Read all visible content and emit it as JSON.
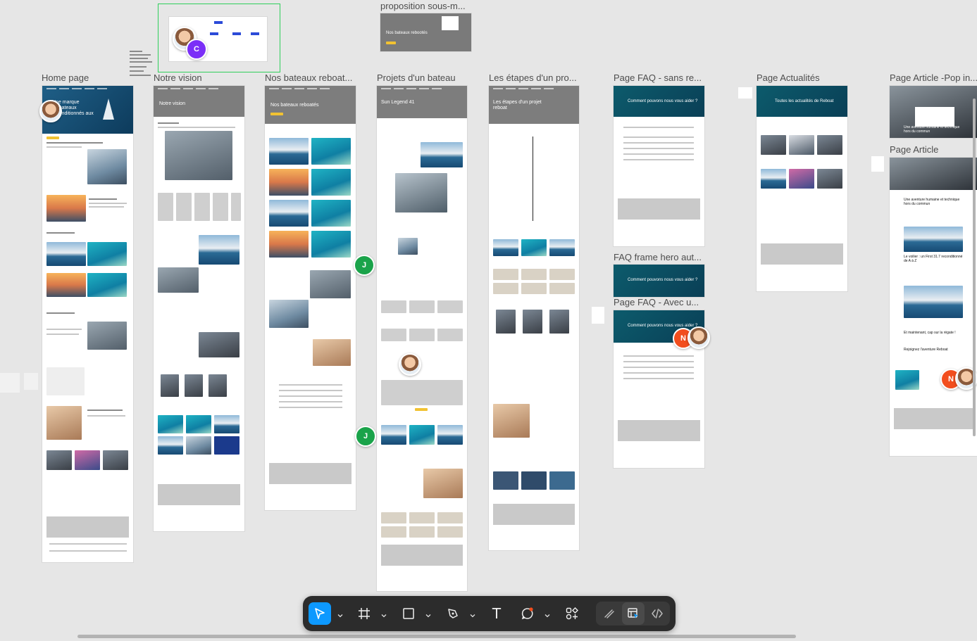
{
  "frames": [
    {
      "id": "home",
      "title": "Home page",
      "hero_text": "Une marque\nde bateaux\nreconditionnés aux\n..."
    },
    {
      "id": "vision",
      "title": "Notre vision",
      "hero_text": "Notre vision"
    },
    {
      "id": "bateaux",
      "title": "Nos bateaux reboat...",
      "hero_text": "Nos bateaux reboatés"
    },
    {
      "id": "projets",
      "title": "Projets d'un bateau",
      "hero_text": "Sun Legend 41"
    },
    {
      "id": "etapes",
      "title": "Les étapes d'un pro...",
      "hero_text": "Les étapes d'un projet\nreboat"
    },
    {
      "id": "faq-sans",
      "title": "Page FAQ - sans re...",
      "hero_text": "Comment pouvons nous vous aider ?"
    },
    {
      "id": "faq-hero",
      "title": "FAQ frame hero aut...",
      "hero_text": "Comment pouvons nous vous aider ?"
    },
    {
      "id": "faq-avec",
      "title": "Page FAQ - Avec u...",
      "hero_text": "Comment pouvons nous vous aider ?"
    },
    {
      "id": "actualites",
      "title": "Page Actualités",
      "hero_text": "Toutes les actualités de Reboat"
    },
    {
      "id": "article-pop",
      "title": "Page Article -Pop in...",
      "hero_text": "Une aventure humaine et technique\nhors du commun"
    },
    {
      "id": "article",
      "title": "Page Article",
      "hero_text": "Une aventure humaine et technique\nhors du commun"
    },
    {
      "id": "proposition",
      "title": "proposition sous-m...",
      "hero_text": "Nos bateaux rebootés"
    }
  ],
  "article_headings": {
    "h1": "Une aventure humaine et technique hors du commun",
    "h2": "Le voilier : un First 31.7 reconditionné de A à Z",
    "h3": "Et maintenant, cap sur la régate !",
    "h4": "Rejoignez l'aventure Reboat"
  },
  "collaborators": [
    {
      "initial": "C",
      "color": "#7b2ff7"
    },
    {
      "initial": "J",
      "color": "#1aa34a"
    },
    {
      "initial": "J",
      "color": "#1aa34a"
    },
    {
      "initial": "N",
      "color": "#f24e1e"
    },
    {
      "initial": "N",
      "color": "#f24e1e"
    }
  ],
  "toolbar": {
    "tools": [
      {
        "name": "move-tool",
        "icon": "cursor-icon",
        "active": true,
        "has_menu": true
      },
      {
        "name": "frame-tool",
        "icon": "frame-icon",
        "active": false,
        "has_menu": true
      },
      {
        "name": "shape-tool",
        "icon": "rectangle-icon",
        "active": false,
        "has_menu": true
      },
      {
        "name": "pen-tool",
        "icon": "pen-icon",
        "active": false,
        "has_menu": true
      },
      {
        "name": "text-tool",
        "icon": "text-icon",
        "active": false,
        "has_menu": false
      },
      {
        "name": "comment-tool",
        "icon": "comment-icon",
        "active": false,
        "has_menu": true
      },
      {
        "name": "resources-tool",
        "icon": "components-icon",
        "active": false,
        "has_menu": false
      }
    ],
    "modes": [
      {
        "name": "draw-mode",
        "icon": "draw-icon"
      },
      {
        "name": "design-mode",
        "icon": "design-icon"
      },
      {
        "name": "dev-mode",
        "icon": "code-icon"
      }
    ],
    "text_tool_label": "T"
  },
  "colors": {
    "canvas": "#e6e6e6",
    "accent": "#0d99ff",
    "selection": "#2fcf5b",
    "cta": "#f1c232"
  }
}
